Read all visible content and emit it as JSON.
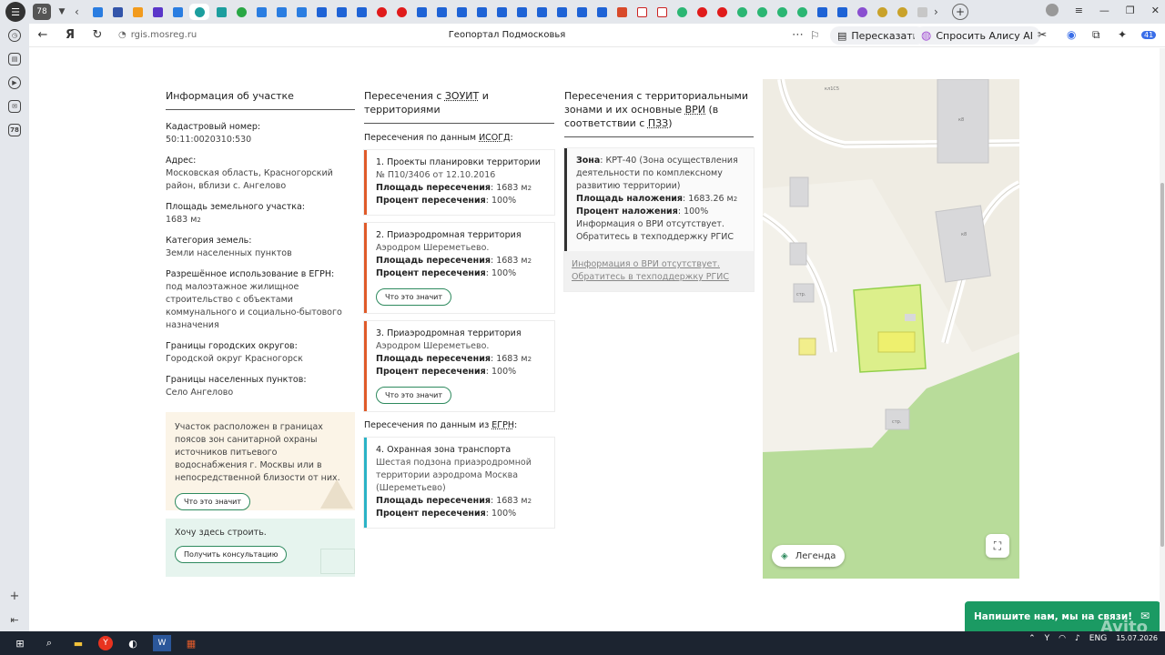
{
  "browser": {
    "tab_count": "78",
    "url": "rgis.mosreg.ru",
    "page_title": "Геопортал Подмосковья",
    "retell_label": "Пересказать",
    "alice_label": "Спросить Алису AI",
    "notifications_badge": "41"
  },
  "sidebar": {
    "badge": "78"
  },
  "info": {
    "title": "Информация об участке",
    "cadastral_label": "Кадастровый номер",
    "cadastral_value": "50:11:0020310:530",
    "address_label": "Адрес",
    "address_value": "Московская область, Красногорский район, вблизи с. Ангелово",
    "area_label": "Площадь земельного участка",
    "area_value": "1683 м",
    "category_label": "Категория земель",
    "category_value": "Земли населенных пунктов",
    "use_label": "Разрешённое использование в ЕГРН",
    "use_value": "под малоэтажное жилищное строительство с объектами коммунального и социально-бытового назначения",
    "district_label": "Границы городских округов",
    "district_value": "Городской округ Красногорск",
    "settlement_label": "Границы населенных пунктов",
    "settlement_value": "Село Ангелово",
    "notice_text": "Участок расположен в границах поясов зон санитарной охраны источников питьевого водоснабжения г. Москвы или в непосредственной близости от них.",
    "what_btn": "Что это значит",
    "build_text": "Хочу здесь строить.",
    "consult_btn": "Получить консультацию"
  },
  "intersections": {
    "title_pre": "Пересечения с ",
    "title_abbr": "ЗОУИТ",
    "title_post": " и территориями",
    "isogd_pre": "Пересечения по данным ",
    "isogd_abbr": "ИСОГД",
    "egrn_pre": "Пересечения по данным из ",
    "egrn_abbr": "ЕГРН",
    "area_label": "Площадь пересечения",
    "pct_label": "Процент пересечения",
    "what_btn": "Что это значит",
    "cards": [
      {
        "title": "1. Проекты планировки территории",
        "desc": "№ П10/3406 от 12.10.2016",
        "area": "1683 м",
        "pct": "100%"
      },
      {
        "title": "2. Приаэродромная территория",
        "desc": "Аэродром Шереметьево.",
        "area": "1683 м",
        "pct": "100%"
      },
      {
        "title": "3. Приаэродромная территория",
        "desc": "Аэродром Шереметьево.",
        "area": "1683 м",
        "pct": "100%"
      },
      {
        "title": "4. Охранная зона транспорта",
        "desc": "Шестая подзона приаэродромной территории аэродрома Москва (Шереметьево)",
        "area": "1683 м",
        "pct": "100%"
      }
    ]
  },
  "zones": {
    "title_pre": "Пересечения с территориальными зонами и их основные ",
    "title_abbr1": "ВРИ",
    "title_mid": " (в соответствии с ",
    "title_abbr2": "ПЗЗ",
    "title_post": ")",
    "zone_label": "Зона",
    "zone_value": "КРТ-40 (Зона осуществления деятельности по комплексному развитию территории)",
    "overlap_label": "Площадь наложения",
    "overlap_value": "1683.26 м",
    "pct_label": "Процент наложения",
    "pct_value": "100%",
    "vri_text": "Информация о ВРИ отсутствует. Обратитесь в техподдержку РГИС",
    "vri_link": "Информация о ВРИ отсутствует. Обратитесь в техподдержку РГИС"
  },
  "map": {
    "legend_label": "Легенда",
    "labels": {
      "building1": "кл1С5",
      "building2": "к8",
      "building3": "к8",
      "str1": "стр.",
      "str2": "стр."
    }
  },
  "chat": {
    "label": "Напишите нам, мы на связи!",
    "watermark": "Avito"
  },
  "taskbar": {
    "lang": "ENG",
    "date": "15.07.2026"
  }
}
